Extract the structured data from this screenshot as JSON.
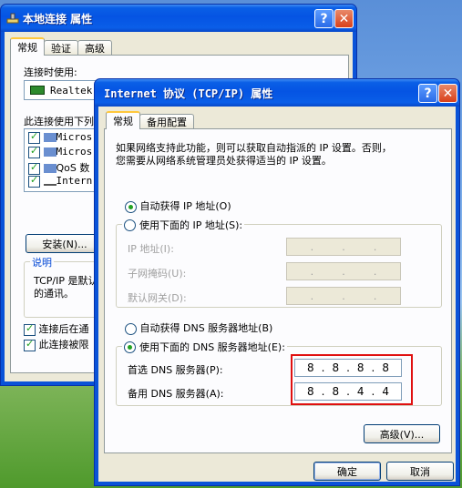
{
  "back_window": {
    "title": "本地连接 属性",
    "tabs": [
      "常规",
      "验证",
      "高级"
    ],
    "connect_using_label": "连接时使用:",
    "adapter_name": "Realtek",
    "components_label": "此连接使用下列",
    "components": [
      "Micros",
      "Micros",
      "QoS 数",
      "Intern"
    ],
    "install_button": "安装(N)...",
    "description_title": "说明",
    "description_text_1": "TCP/IP 是默认",
    "description_text_2": "的通讯。",
    "check_show_icon": "连接后在通",
    "check_notify": "此连接被限"
  },
  "front_window": {
    "title": "Internet 协议 (TCP/IP) 属性",
    "tabs": [
      "常规",
      "备用配置"
    ],
    "intro_line_1": "如果网络支持此功能，则可以获取自动指派的 IP 设置。否则，",
    "intro_line_2": "您需要从网络系统管理员处获得适当的 IP 设置。",
    "radio_auto_ip": "自动获得 IP 地址(O)",
    "radio_manual_ip": "使用下面的 IP 地址(S):",
    "ip_label": "IP 地址(I):",
    "mask_label": "子网掩码(U):",
    "gateway_label": "默认网关(D):",
    "radio_auto_dns": "自动获得 DNS 服务器地址(B)",
    "radio_manual_dns": "使用下面的 DNS 服务器地址(E):",
    "preferred_dns_label": "首选 DNS 服务器(P):",
    "alternate_dns_label": "备用 DNS 服务器(A):",
    "preferred_dns": [
      "8",
      "8",
      "8",
      "8"
    ],
    "alternate_dns": [
      "8",
      "8",
      "4",
      "4"
    ],
    "ip_dots": ".",
    "advanced_button": "高级(V)...",
    "ok_button": "确定",
    "cancel_button": "取消"
  },
  "help_glyph": "?",
  "close_glyph": "✕",
  "colors": {
    "highlight": "#e01010",
    "title_blue": "#0554e3"
  }
}
